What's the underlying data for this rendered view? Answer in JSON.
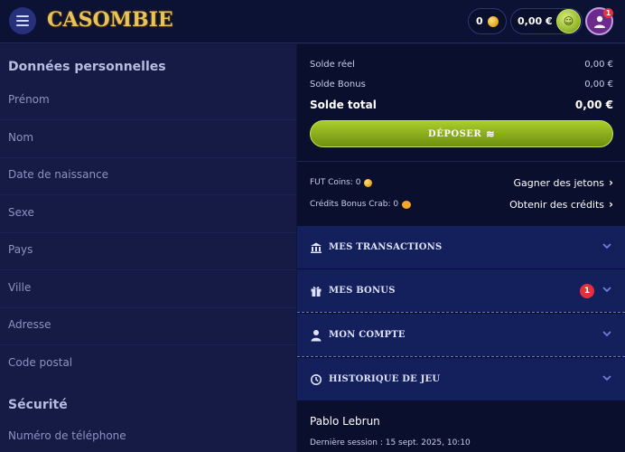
{
  "header": {
    "logo_text": "CASOMBIE",
    "coins_count": "0",
    "balance": "0,00 €",
    "notification_count": "1"
  },
  "left": {
    "personal_title": "Données personnelles",
    "fields": [
      "Prénom",
      "Nom",
      "Date de naissance",
      "Sexe",
      "Pays",
      "Ville",
      "Adresse",
      "Code postal"
    ],
    "security_title": "Sécurité",
    "security_fields": [
      "Numéro de téléphone"
    ]
  },
  "wallet": {
    "real_label": "Solde réel",
    "real_value": "0,00 €",
    "bonus_label": "Solde Bonus",
    "bonus_value": "0,00 €",
    "total_label": "Solde total",
    "total_value": "0,00 €",
    "deposit_label": "DÉPOSER"
  },
  "currencies": {
    "fut_label": "FUT Coins: 0",
    "fut_link": "Gagner des jetons",
    "crab_label": "Crédits Bonus Crab: 0",
    "crab_link": "Obtenir des crédits"
  },
  "accordion": {
    "transactions": "MES TRANSACTIONS",
    "bonus": "MES BONUS",
    "bonus_badge": "1",
    "account": "MON COMPTE",
    "history": "HISTORIQUE DE JEU"
  },
  "user": {
    "name": "Pablo Lebrun",
    "last_session": "Dernière session : 15 sept. 2025, 10:10"
  },
  "colors": {
    "accent_green": "#a9cd2a",
    "badge_red": "#e0313c",
    "logo_gold": "#e8c35a"
  }
}
